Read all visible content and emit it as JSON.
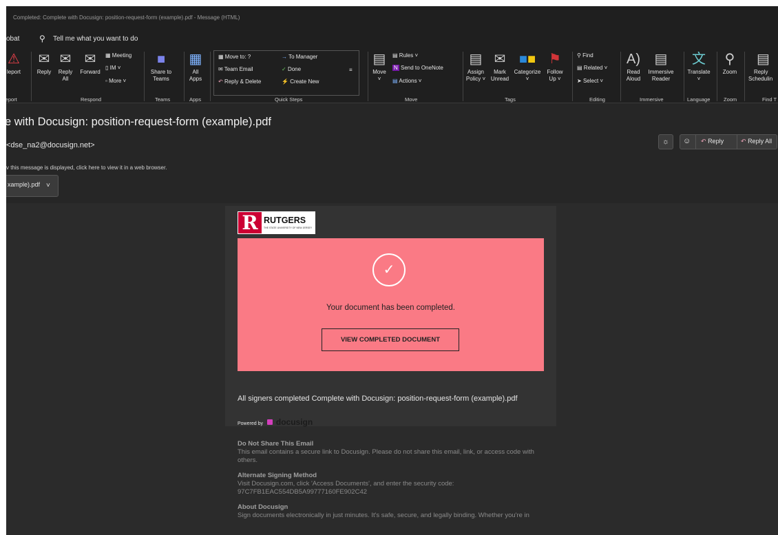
{
  "window": {
    "title": "Completed: Complete with Docusign: position-request-form (example).pdf  -  Message (HTML)"
  },
  "menubar": {
    "acrobat": "obat",
    "tell_me": "Tell me what you want to do"
  },
  "ribbon": {
    "report": {
      "label": "leport",
      "group": "leport"
    },
    "respond": {
      "reply": "Reply",
      "reply_all_1": "Reply",
      "reply_all_2": "All",
      "forward": "Forward",
      "meeting": "Meeting",
      "im": "IM",
      "more": "More",
      "group": "Respond"
    },
    "teams": {
      "share_1": "Share to",
      "share_2": "Teams",
      "group": "Teams"
    },
    "apps": {
      "all_1": "All",
      "all_2": "Apps",
      "group": "Apps"
    },
    "quick_steps": {
      "move_to": "Move to: ?",
      "to_manager": "To Manager",
      "team_email": "Team Email",
      "done": "Done",
      "reply_delete": "Reply & Delete",
      "create_new": "Create New",
      "group": "Quick Steps"
    },
    "move": {
      "move": "Move",
      "rules": "Rules",
      "send_onenote": "Send to OneNote",
      "actions": "Actions",
      "group": "Move"
    },
    "tags": {
      "assign_1": "Assign",
      "assign_2": "Policy",
      "mark_1": "Mark",
      "mark_2": "Unread",
      "categorize": "Categorize",
      "follow_1": "Follow",
      "follow_2": "Up",
      "group": "Tags"
    },
    "editing": {
      "find": "Find",
      "related": "Related",
      "select": "Select",
      "group": "Editing"
    },
    "immersive": {
      "read_1": "Read",
      "read_2": "Aloud",
      "reader_1": "Immersive",
      "reader_2": "Reader",
      "group": "Immersive"
    },
    "language": {
      "translate": "Translate",
      "group": "Language"
    },
    "zoom": {
      "zoom": "Zoom",
      "group": "Zoom"
    },
    "find_time": {
      "label_1": "Reply",
      "label_2": "Schedulin",
      "group": "Find T"
    }
  },
  "message": {
    "subject": "e with Docusign: position-request-form (example).pdf",
    "from": "<dse_na2@docusign.net>",
    "info_bar": "v this message is displayed, click here to view it in a web browser.",
    "attachment": "xample).pdf",
    "actions": {
      "reply": "Reply",
      "reply_all": "Reply All"
    }
  },
  "email": {
    "logo_text": "RUTGERS",
    "logo_sub": "THE STATE UNIVERSITY OF NEW JERSEY",
    "completed_text": "Your document has been completed.",
    "view_button": "VIEW COMPLETED DOCUMENT",
    "all_signers": "All signers completed Complete with Docusign: position-request-form (example).pdf",
    "powered_by": "Powered by",
    "docusign": "docusign",
    "footer": {
      "h1": "Do Not Share This Email",
      "p1a": "This email contains a secure link to Docusign. Please do not share this email, link, or access code with",
      "p1b": "others.",
      "h2": "Alternate Signing Method",
      "p2a": "Visit Docusign.com, click 'Access Documents', and enter the security code:",
      "p2b": "97C7FB1EAC554DB5A99777160FE902C42",
      "h3": "About Docusign",
      "p3a": "Sign documents electronically in just minutes. It's safe, secure, and legally binding. Whether you're in"
    }
  },
  "colors": {
    "pink_panel": "#fa7a85",
    "report_icon": "#e8404a",
    "teams_icon": "#7b83eb",
    "onenote": "#7719aa",
    "flag": "#d13438"
  }
}
